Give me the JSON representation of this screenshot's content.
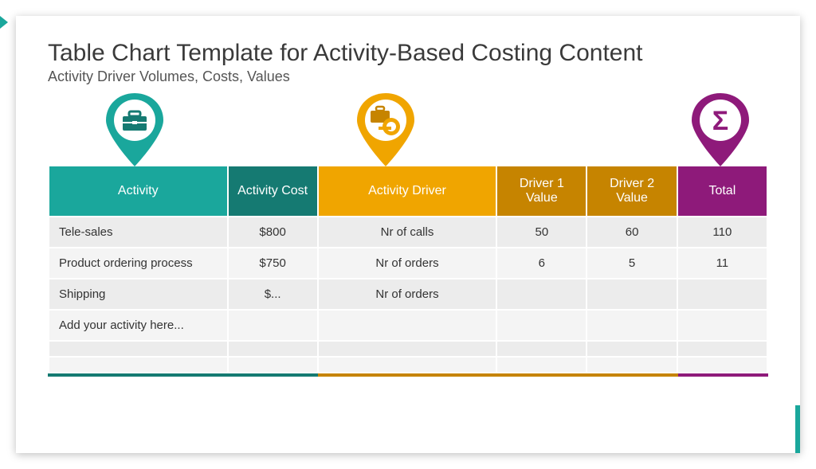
{
  "title": "Table Chart Template for Activity-Based Costing Content",
  "subtitle": "Activity Driver Volumes, Costs, Values",
  "headers": {
    "activity": "Activity",
    "cost": "Activity Cost",
    "driver": "Activity Driver",
    "d1": "Driver 1 Value",
    "d2": "Driver 2 Value",
    "total": "Total"
  },
  "rows": [
    {
      "activity": "Tele-sales",
      "cost": "$800",
      "driver": "Nr of calls",
      "d1": "50",
      "d2": "60",
      "total": "110"
    },
    {
      "activity": "Product ordering process",
      "cost": "$750",
      "driver": "Nr of orders",
      "d1": "6",
      "d2": "5",
      "total": "11"
    },
    {
      "activity": "Shipping",
      "cost": "$...",
      "driver": "Nr of orders",
      "d1": "",
      "d2": "",
      "total": ""
    },
    {
      "activity": "Add your activity here...",
      "cost": "",
      "driver": "",
      "d1": "",
      "d2": "",
      "total": ""
    },
    {
      "activity": "",
      "cost": "",
      "driver": "",
      "d1": "",
      "d2": "",
      "total": ""
    },
    {
      "activity": "",
      "cost": "",
      "driver": "",
      "d1": "",
      "d2": "",
      "total": ""
    }
  ],
  "colors": {
    "teal": "#1aa79c",
    "tealDark": "#157a72",
    "orange": "#f0a500",
    "orangeDark": "#c68400",
    "magenta": "#8e1a7a"
  },
  "icons": {
    "pin1": "briefcase-icon",
    "pin2": "briefcase-tape-icon",
    "pin3": "sigma-icon"
  }
}
